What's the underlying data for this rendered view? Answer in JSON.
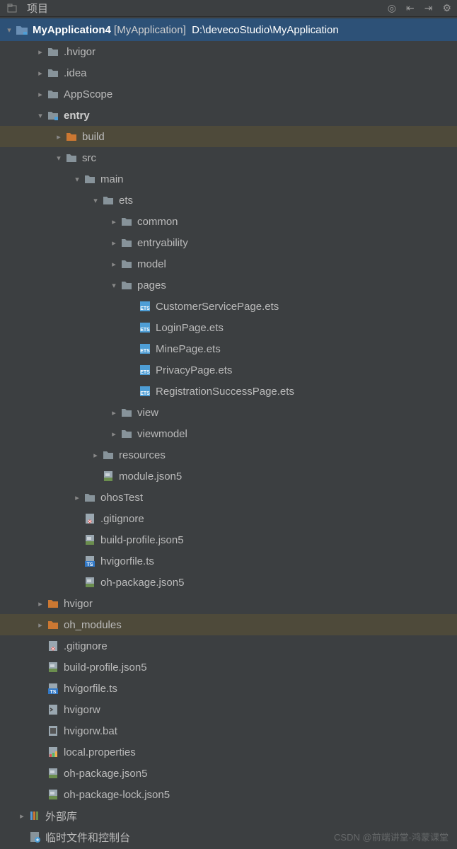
{
  "toolbar": {
    "title": "项目"
  },
  "root": {
    "name": "MyApplication4",
    "bracket": "[MyApplication]",
    "path": "D:\\devecoStudio\\MyApplication"
  },
  "tree": [
    {
      "d": 1,
      "a": "r",
      "i": "folder",
      "t": ".hvigor"
    },
    {
      "d": 1,
      "a": "r",
      "i": "folder",
      "t": ".idea"
    },
    {
      "d": 1,
      "a": "r",
      "i": "folder",
      "t": "AppScope"
    },
    {
      "d": 1,
      "a": "d",
      "i": "module",
      "t": "entry",
      "bold": true
    },
    {
      "d": 2,
      "a": "r",
      "i": "folder-o",
      "t": "build",
      "sel": true
    },
    {
      "d": 2,
      "a": "d",
      "i": "folder",
      "t": "src"
    },
    {
      "d": 3,
      "a": "d",
      "i": "folder",
      "t": "main"
    },
    {
      "d": 4,
      "a": "d",
      "i": "folder",
      "t": "ets"
    },
    {
      "d": 5,
      "a": "r",
      "i": "folder",
      "t": "common"
    },
    {
      "d": 5,
      "a": "r",
      "i": "folder",
      "t": "entryability"
    },
    {
      "d": 5,
      "a": "r",
      "i": "folder",
      "t": "model"
    },
    {
      "d": 5,
      "a": "d",
      "i": "folder",
      "t": "pages"
    },
    {
      "d": 6,
      "a": "",
      "i": "ets",
      "t": "CustomerServicePage.ets"
    },
    {
      "d": 6,
      "a": "",
      "i": "ets",
      "t": "LoginPage.ets"
    },
    {
      "d": 6,
      "a": "",
      "i": "ets",
      "t": "MinePage.ets"
    },
    {
      "d": 6,
      "a": "",
      "i": "ets",
      "t": "PrivacyPage.ets"
    },
    {
      "d": 6,
      "a": "",
      "i": "ets",
      "t": "RegistrationSuccessPage.ets"
    },
    {
      "d": 5,
      "a": "r",
      "i": "folder",
      "t": "view"
    },
    {
      "d": 5,
      "a": "r",
      "i": "folder",
      "t": "viewmodel"
    },
    {
      "d": 4,
      "a": "r",
      "i": "folder",
      "t": "resources"
    },
    {
      "d": 4,
      "a": "",
      "i": "json5",
      "t": "module.json5"
    },
    {
      "d": 3,
      "a": "r",
      "i": "folder",
      "t": "ohosTest"
    },
    {
      "d": 3,
      "a": "",
      "i": "git",
      "t": ".gitignore"
    },
    {
      "d": 3,
      "a": "",
      "i": "json5",
      "t": "build-profile.json5"
    },
    {
      "d": 3,
      "a": "",
      "i": "ts",
      "t": "hvigorfile.ts"
    },
    {
      "d": 3,
      "a": "",
      "i": "json5",
      "t": "oh-package.json5"
    },
    {
      "d": 1,
      "a": "r",
      "i": "folder-o",
      "t": "hvigor"
    },
    {
      "d": 1,
      "a": "r",
      "i": "folder-o",
      "t": "oh_modules",
      "sel": true
    },
    {
      "d": 1,
      "a": "",
      "i": "git",
      "t": ".gitignore"
    },
    {
      "d": 1,
      "a": "",
      "i": "json5",
      "t": "build-profile.json5"
    },
    {
      "d": 1,
      "a": "",
      "i": "ts",
      "t": "hvigorfile.ts"
    },
    {
      "d": 1,
      "a": "",
      "i": "sh",
      "t": "hvigorw"
    },
    {
      "d": 1,
      "a": "",
      "i": "bat",
      "t": "hvigorw.bat"
    },
    {
      "d": 1,
      "a": "",
      "i": "prop",
      "t": "local.properties"
    },
    {
      "d": 1,
      "a": "",
      "i": "json5",
      "t": "oh-package.json5"
    },
    {
      "d": 1,
      "a": "",
      "i": "json5",
      "t": "oh-package-lock.json5"
    },
    {
      "d": 0,
      "a": "r",
      "i": "lib",
      "t": "外部库"
    },
    {
      "d": 0,
      "a": "",
      "i": "scratch",
      "t": "临时文件和控制台"
    }
  ],
  "watermark": "CSDN @前端讲堂-鸿蒙课堂"
}
